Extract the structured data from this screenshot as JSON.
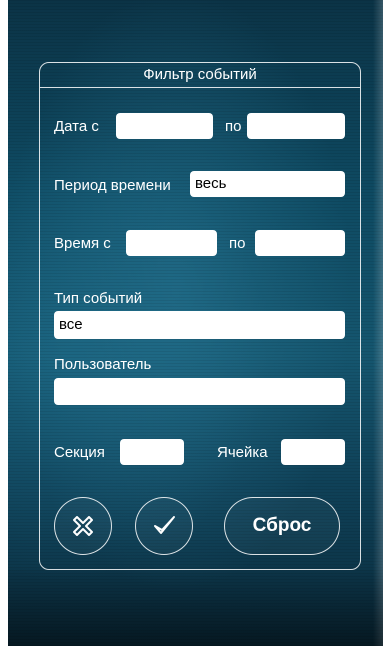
{
  "filter": {
    "title": "Фильтр событий",
    "date_from_label": "Дата с",
    "date_from_value": "",
    "date_to_label": "по",
    "date_to_value": "",
    "period_label": "Период времени",
    "period_value": "весь",
    "time_from_label": "Время с",
    "time_from_value": "",
    "time_to_label": "по",
    "time_to_value": "",
    "event_type_label": "Тип событий",
    "event_type_value": "все",
    "user_label": "Пользователь",
    "user_value": "",
    "section_label": "Секция",
    "section_value": "",
    "cell_label": "Ячейка",
    "cell_value": ""
  },
  "actions": {
    "cancel_icon": "close-icon",
    "apply_icon": "check-icon",
    "reset_label": "Сброс"
  },
  "colors": {
    "background": "#0e4a62",
    "panel_border": "#ffffff",
    "text": "#ffffff",
    "field_bg": "#ffffff"
  }
}
